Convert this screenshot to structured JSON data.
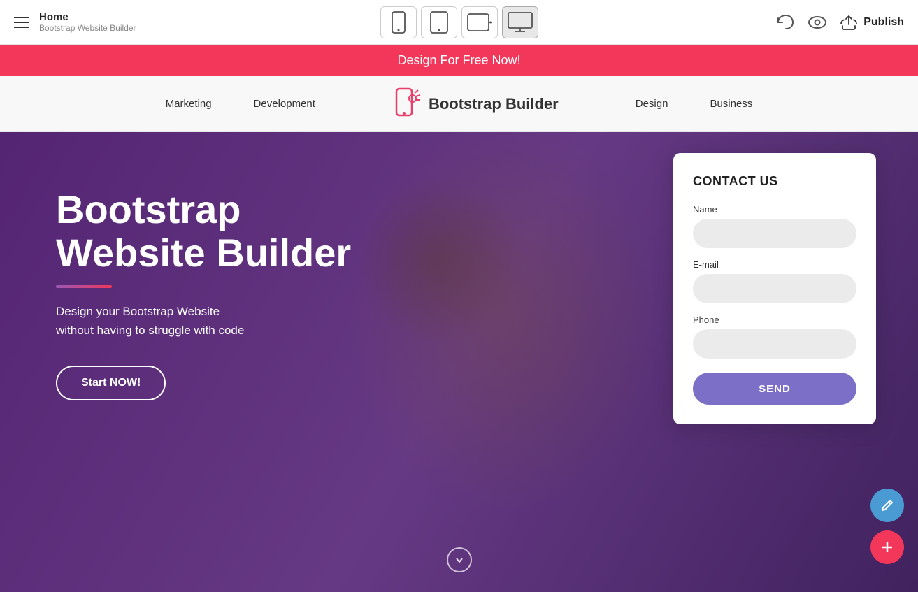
{
  "topbar": {
    "title": "Home",
    "subtitle": "Bootstrap Website Builder",
    "devices": [
      {
        "id": "mobile",
        "label": "Mobile"
      },
      {
        "id": "tablet",
        "label": "Tablet"
      },
      {
        "id": "tablet-landscape",
        "label": "Tablet Landscape"
      },
      {
        "id": "desktop",
        "label": "Desktop",
        "active": true
      }
    ],
    "undo_label": "↩",
    "preview_label": "👁",
    "publish_label": "Publish"
  },
  "promo": {
    "text": "Design For Free Now!"
  },
  "site_nav": {
    "links": [
      "Marketing",
      "Development",
      "Design",
      "Business"
    ],
    "logo_text": "Bootstrap Builder"
  },
  "hero": {
    "title": "Bootstrap\nWebsite Builder",
    "subtitle": "Design your Bootstrap Website\nwithout having to struggle with code",
    "cta_label": "Start NOW!"
  },
  "contact_form": {
    "title": "CONTACT US",
    "name_label": "Name",
    "name_placeholder": "",
    "email_label": "E-mail",
    "email_placeholder": "",
    "phone_label": "Phone",
    "phone_placeholder": "",
    "send_label": "SEND"
  },
  "fab": {
    "edit_icon": "✎",
    "add_icon": "+"
  }
}
